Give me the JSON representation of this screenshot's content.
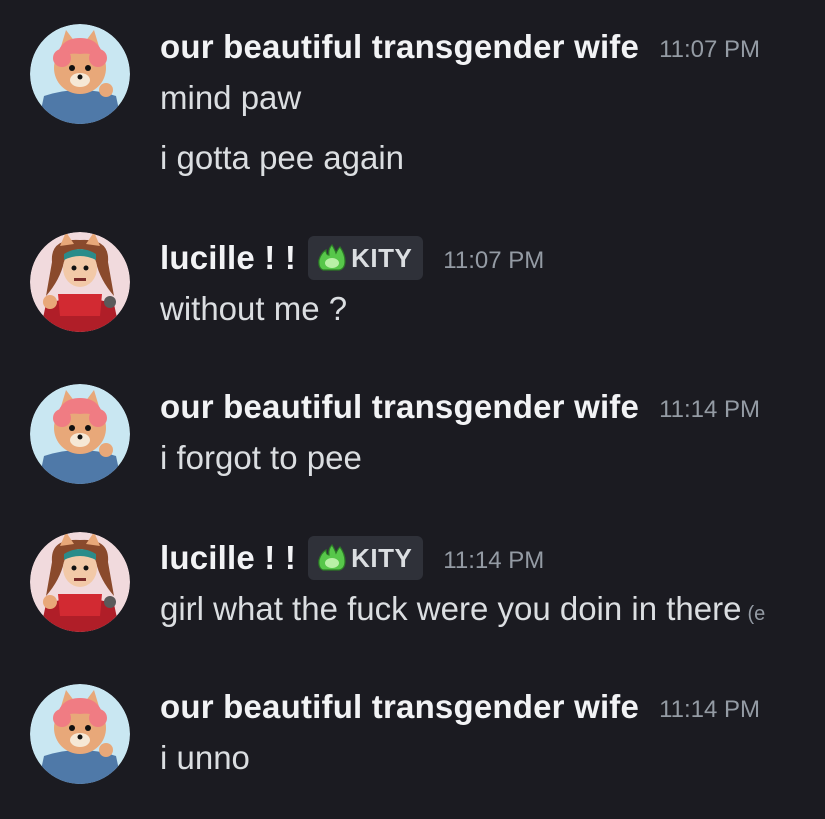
{
  "messages": [
    {
      "author": "our beautiful transgender wife",
      "time": "11:07 PM",
      "lines": [
        "mind paw",
        "i gotta pee again"
      ]
    },
    {
      "author": "lucille ! !",
      "tag": {
        "label": "KITY",
        "icon": "green-flame-icon"
      },
      "time": "11:07 PM",
      "lines": [
        "without me ?"
      ]
    },
    {
      "author": "our beautiful transgender wife",
      "time": "11:14 PM",
      "lines": [
        "i forgot to pee"
      ]
    },
    {
      "author": "lucille ! !",
      "tag": {
        "label": "KITY",
        "icon": "green-flame-icon"
      },
      "time": "11:14 PM",
      "lines": [
        "girl what the fuck were you doin in there"
      ],
      "edited_marker": "(e"
    },
    {
      "author": "our beautiful transgender wife",
      "time": "11:14 PM",
      "lines": [
        "i unno"
      ]
    }
  ],
  "colors": {
    "background": "#1b1b21",
    "username": "#f2f3f5",
    "message_text": "#dbdee1",
    "timestamp": "#949ba4",
    "tag_background": "#2f3139",
    "tag_icon": "#57c74a"
  }
}
